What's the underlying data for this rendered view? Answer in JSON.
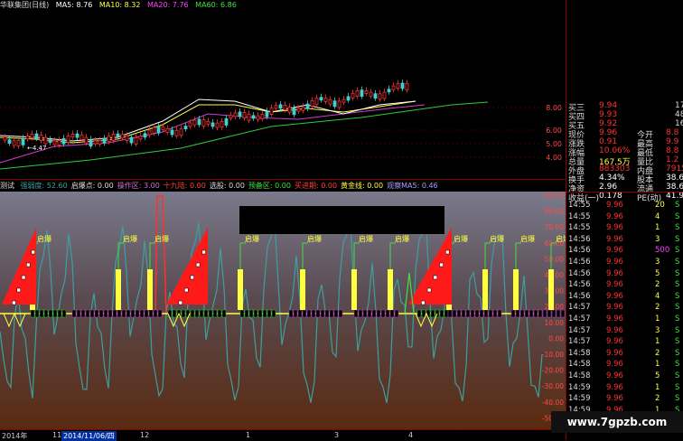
{
  "top_legend": {
    "title": "华联集团(日线)",
    "ma5": "MA5: 8.76",
    "ma10": "MA10: 8.32",
    "ma20": "MA20: 7.76",
    "ma60": "MA60: 6.86"
  },
  "price_axis": {
    "labels": [
      "8.00",
      "6.00",
      "5.00",
      "4.00"
    ],
    "low_marker": "4.47"
  },
  "indicator_legend": {
    "name": "测试",
    "items": [
      {
        "label": "强弱度: 52.60",
        "color": "#3aa0a0"
      },
      {
        "label": "启爆点: 0.00",
        "color": "#dddddd"
      },
      {
        "label": "操作区: 3.00",
        "color": "#d070d0"
      },
      {
        "label": "十九陆: 0.00",
        "color": "#ff4040"
      },
      {
        "label": "选股: 0.00",
        "color": "#dddddd"
      },
      {
        "label": "预备区: 0.00",
        "color": "#40e040"
      },
      {
        "label": "买进期: 0.00",
        "color": "#ff4040"
      },
      {
        "label": "黄金线: 0.00",
        "color": "#ffff40"
      },
      {
        "label": "观察MA5: 0.46",
        "color": "#a0a0ff"
      }
    ]
  },
  "indicator_axis": {
    "labels": [
      "90.00",
      "80.00",
      "70.00",
      "60.00",
      "50.00",
      "40.00",
      "30.00",
      "20.00",
      "10.00",
      "0.00",
      "-10.00",
      "-20.00",
      "-30.00",
      "-40.00",
      "-50.00"
    ]
  },
  "signal_label": "启爆",
  "bottom_axis": {
    "year": "2014年",
    "m11": "11",
    "date_box": "2014/11/06/四",
    "m12": "12",
    "m1": "1",
    "m3": "3",
    "m4": "4"
  },
  "quote_rows": [
    {
      "label": "买三",
      "value": "9.94",
      "extra": "17",
      "color": "#ff3030"
    },
    {
      "label": "买四",
      "value": "9.93",
      "extra": "48",
      "color": "#ff3030"
    },
    {
      "label": "买五",
      "value": "9.92",
      "extra": "16",
      "color": "#ff3030"
    },
    {
      "label": "现价",
      "value": "9.96",
      "label2": "今开",
      "value2": "8.8",
      "color": "#ff3030"
    },
    {
      "label": "涨跌",
      "value": "0.91",
      "label2": "最高",
      "value2": "9.9",
      "color": "#ff3030"
    },
    {
      "label": "涨幅",
      "value": "10.06%",
      "label2": "最低",
      "value2": "8.8",
      "color": "#ff3030"
    },
    {
      "label": "总量",
      "value": "167.5万",
      "label2": "量比",
      "value2": "1.2",
      "color": "#ffff40"
    },
    {
      "label": "外盘",
      "value": "883303",
      "label2": "内盘",
      "value2": "79155",
      "color": "#ff3030"
    },
    {
      "label": "换手",
      "value": "4.34%",
      "label2": "股本",
      "value2": "38.6",
      "color": "#ffffff"
    },
    {
      "label": "净资",
      "value": "2.96",
      "label2": "流通",
      "value2": "38.6",
      "color": "#ffffff"
    },
    {
      "label": "收益(一)",
      "value": "0.178",
      "label2": "PE(动)",
      "value2": "41.9",
      "color": "#ffffff"
    }
  ],
  "trades": [
    {
      "time": "14:55",
      "price": "9.96",
      "vol": "20",
      "flag": "S"
    },
    {
      "time": "14:55",
      "price": "9.96",
      "vol": "4",
      "flag": "S"
    },
    {
      "time": "14:55",
      "price": "9.96",
      "vol": "1",
      "flag": "S"
    },
    {
      "time": "14:56",
      "price": "9.96",
      "vol": "3",
      "flag": "S"
    },
    {
      "time": "14:56",
      "price": "9.96",
      "vol": "500",
      "flag": "S"
    },
    {
      "time": "14:56",
      "price": "9.96",
      "vol": "3",
      "flag": "S"
    },
    {
      "time": "14:56",
      "price": "9.96",
      "vol": "5",
      "flag": "S"
    },
    {
      "time": "14:56",
      "price": "9.96",
      "vol": "2",
      "flag": "S"
    },
    {
      "time": "14:56",
      "price": "9.96",
      "vol": "4",
      "flag": "S"
    },
    {
      "time": "14:57",
      "price": "9.96",
      "vol": "2",
      "flag": "S"
    },
    {
      "time": "14:57",
      "price": "9.96",
      "vol": "1",
      "flag": "S"
    },
    {
      "time": "14:57",
      "price": "9.96",
      "vol": "3",
      "flag": "S"
    },
    {
      "time": "14:57",
      "price": "9.96",
      "vol": "1",
      "flag": "S"
    },
    {
      "time": "14:58",
      "price": "9.96",
      "vol": "2",
      "flag": "S"
    },
    {
      "time": "14:58",
      "price": "9.96",
      "vol": "1",
      "flag": "S"
    },
    {
      "time": "14:58",
      "price": "9.96",
      "vol": "5",
      "flag": "S"
    },
    {
      "time": "14:59",
      "price": "9.96",
      "vol": "1",
      "flag": "S"
    },
    {
      "time": "14:59",
      "price": "9.96",
      "vol": "2",
      "flag": "S"
    },
    {
      "time": "14:59",
      "price": "9.96",
      "vol": "1",
      "flag": "S"
    },
    {
      "time": "14:59",
      "price": "9.96",
      "vol": "4",
      "flag": "S"
    }
  ],
  "watermark": "www.7gpzb.com",
  "colors": {
    "up": "#ff3030",
    "signal": "#ffff40",
    "strength": "#3aa0a0"
  }
}
